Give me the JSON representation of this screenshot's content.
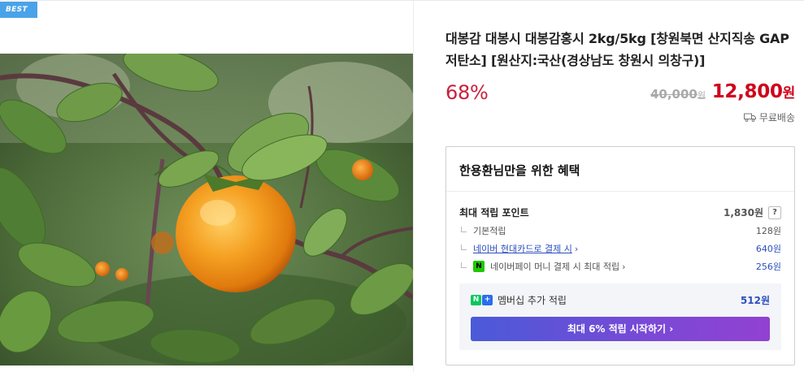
{
  "badge": "BEST",
  "product": {
    "title": "대봉감 대봉시 대봉감홍시 2kg/5kg [창원북면 산지직송 GAP 저탄소] [원산지:국산(경상남도 창원시 의창구)]",
    "discount": "68%",
    "original_price": "40,000",
    "original_price_unit": "원",
    "sale_price": "12,800",
    "sale_price_unit": "원",
    "shipping": "무료배송",
    "image_icon": "persimmon-photo"
  },
  "benefits": {
    "title": "한용환님만을 위한 혜택",
    "max_points_label": "최대 적립 포인트",
    "max_points_value": "1,830원",
    "help_label": "?",
    "basic_label": "기본적립",
    "basic_value": "128원",
    "card_label": "네이버 현대카드로 결제 시",
    "card_value": "640원",
    "pay_label": "네이버페이 머니 결제 시 최대 적립",
    "pay_value": "256원",
    "npay_icon_text": "N",
    "member_label": "멤버십 추가 적립",
    "member_value": "512원",
    "nplus_n": "N",
    "nplus_plus": "+",
    "cta_label": "최대 6% 적립 시작하기",
    "chevron": "›"
  },
  "colors": {
    "discount": "#c6213c",
    "sale_price": "#d0021b",
    "badge": "#4aa3e8",
    "link": "#2c4fbd"
  }
}
